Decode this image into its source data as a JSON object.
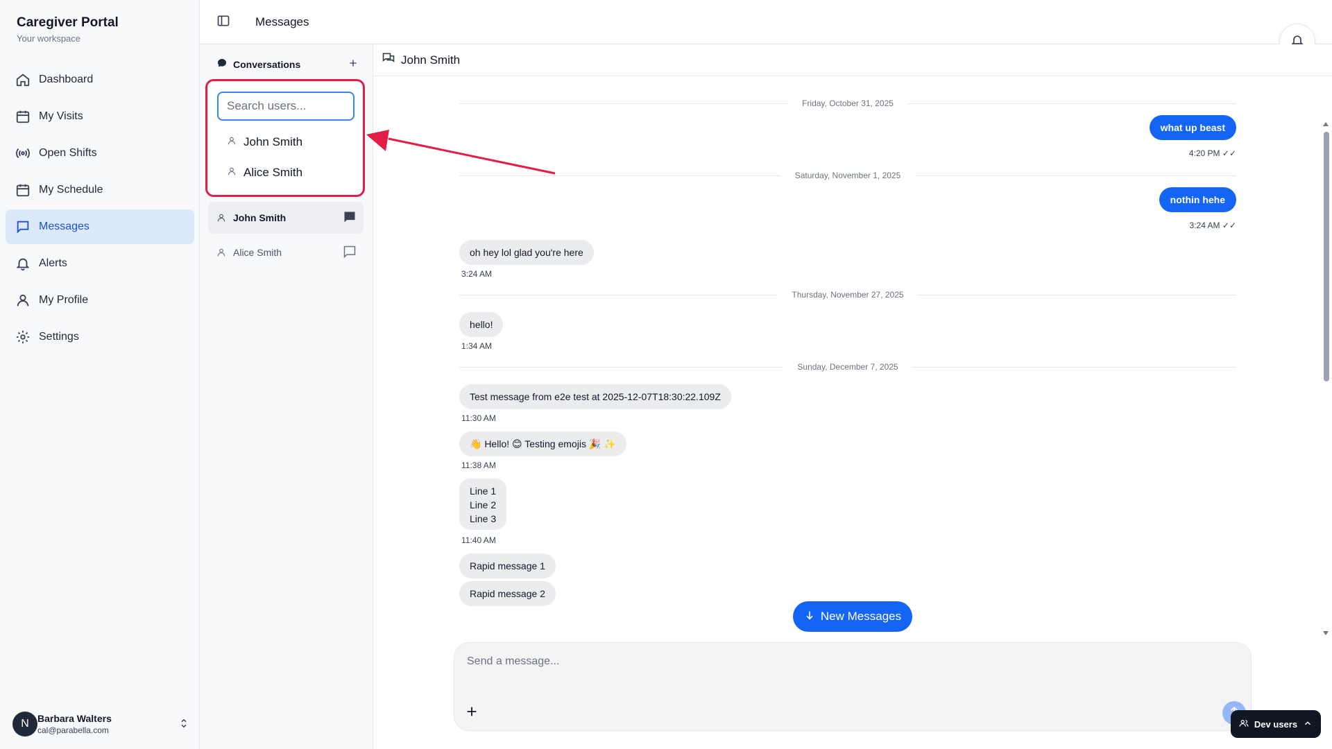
{
  "brand": {
    "title": "Caregiver Portal",
    "subtitle": "Your workspace"
  },
  "nav": {
    "items": [
      {
        "label": "Dashboard",
        "icon": "home-icon"
      },
      {
        "label": "My Visits",
        "icon": "calendar-icon"
      },
      {
        "label": "Open Shifts",
        "icon": "broadcast-icon"
      },
      {
        "label": "My Schedule",
        "icon": "calendar-icon"
      },
      {
        "label": "Messages",
        "icon": "message-square-icon",
        "active": true
      },
      {
        "label": "Alerts",
        "icon": "bell-icon"
      },
      {
        "label": "My Profile",
        "icon": "user-icon"
      },
      {
        "label": "Settings",
        "icon": "gear-icon"
      }
    ]
  },
  "user": {
    "initial": "N",
    "name": "Barbara Walters",
    "email": "cal@parabella.com"
  },
  "header": {
    "title": "Messages"
  },
  "conversations": {
    "title": "Conversations",
    "search_placeholder": "Search users...",
    "search_results": [
      "John Smith",
      "Alice Smith"
    ],
    "list": [
      {
        "name": "John Smith",
        "active": true
      },
      {
        "name": "Alice Smith",
        "active": false
      }
    ]
  },
  "chat": {
    "contact": "John Smith",
    "dates": [
      "Friday, October 31, 2025",
      "Saturday, November 1, 2025",
      "Thursday, November 27, 2025",
      "Sunday, December 7, 2025"
    ],
    "messages": [
      {
        "text": "what up beast",
        "time": "4:20 PM ✓✓"
      },
      {
        "text": "nothin hehe",
        "time": "3:24 AM ✓✓"
      },
      {
        "text": "oh hey lol glad you're here",
        "time": "3:24 AM"
      },
      {
        "text": "hello!",
        "time": "1:34 AM"
      },
      {
        "text": "Test message from e2e test at 2025-12-07T18:30:22.109Z",
        "time": "11:30 AM"
      },
      {
        "text": "👋 Hello! 😊 Testing emojis 🎉 ✨",
        "time": "11:38 AM"
      },
      {
        "line1": "Line 1",
        "line2": "Line 2",
        "line3": "Line 3",
        "time": "11:40 AM"
      },
      {
        "text": "Rapid message 1"
      },
      {
        "text": "Rapid message 2"
      }
    ],
    "new_messages_label": "New Messages",
    "composer_placeholder": "Send a message..."
  },
  "dev_users_label": "Dev users",
  "colors": {
    "accent": "#1565f5",
    "active_nav_bg": "#dbe9fb",
    "highlight": "#e11d48"
  }
}
